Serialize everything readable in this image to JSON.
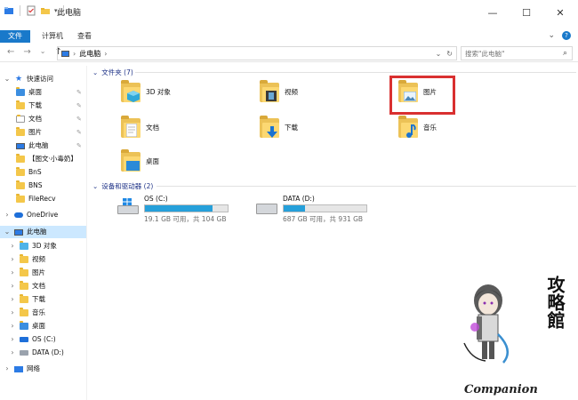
{
  "window": {
    "title": "此电脑",
    "minimize": "—",
    "maximize": "☐",
    "close": "✕"
  },
  "ribbon": {
    "tabs": [
      "文件",
      "计算机",
      "查看"
    ],
    "expand": "⌄",
    "help": "?"
  },
  "address": {
    "back": "←",
    "forward": "→",
    "recent": "⌄",
    "up": "↑",
    "sep1": "›",
    "crumb": "此电脑",
    "sep2": "›",
    "dropdown": "⌄",
    "refresh": "↻",
    "search_placeholder": "搜索\"此电脑\"",
    "search_icon": "⌕"
  },
  "sidebar": {
    "quick_access": "快速访问",
    "quick_items": [
      "桌面",
      "下载",
      "文档",
      "图片",
      "此电脑",
      "【图文·小毒奶】",
      "BnS",
      "BNS",
      "FileRecv"
    ],
    "onedrive": "OneDrive",
    "this_pc": "此电脑",
    "pc_items": [
      "3D 对象",
      "视频",
      "图片",
      "文档",
      "下载",
      "音乐",
      "桌面",
      "OS (C:)",
      "DATA (D:)"
    ],
    "network": "网络"
  },
  "main": {
    "folders_header": "文件夹 (7)",
    "folders": [
      "3D 对象",
      "视频",
      "图片",
      "文档",
      "下载",
      "音乐",
      "桌面"
    ],
    "devices_header": "设备和驱动器 (2)",
    "drives": [
      {
        "name": "OS (C:)",
        "free": "19.1 GB 可用，共 104 GB",
        "used_fraction": 0.82
      },
      {
        "name": "DATA (D:)",
        "free": "687 GB 可用，共 931 GB",
        "used_fraction": 0.26
      }
    ]
  },
  "watermark": {
    "brush_text": "攻略館",
    "logo_text": "Companion"
  },
  "colors": {
    "accent": "#1979ca",
    "selection": "#cce8ff",
    "highlight_box": "#d93030",
    "drive_bar": "#26a0da"
  }
}
